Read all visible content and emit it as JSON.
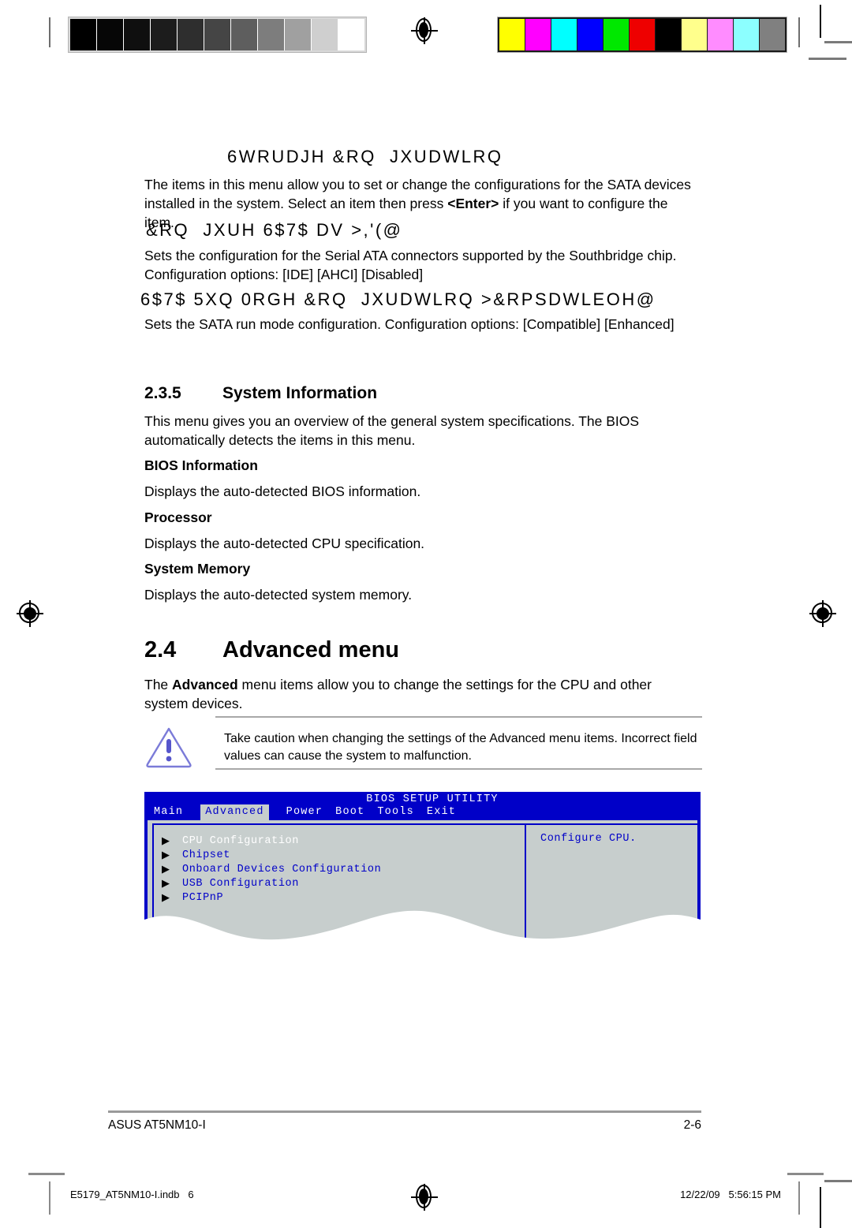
{
  "print_marks": {
    "grayscale_patches": [
      "#000000",
      "#060606",
      "#0f0f0f",
      "#1c1c1c",
      "#2e2e2e",
      "#454545",
      "#5e5e5e",
      "#7d7d7d",
      "#a0a0a0",
      "#cfcfcf",
      "#ffffff"
    ],
    "color_patches": [
      "#ffff00",
      "#ff00ff",
      "#00ffff",
      "#0000ff",
      "#00e800",
      "#ee0000",
      "#000000",
      "#ffff8c",
      "#ff8cff",
      "#8cffff",
      "#808080"
    ],
    "registration_mark": "registration-target-icon"
  },
  "content": {
    "heading_storage_config": "6WRUDJH &RQ  JXUDWLRQ",
    "para_storage_1": "The items in this menu allow you to set or change the configurations for the SATA devices installed in the system. Select an item then press ",
    "para_storage_1_bold": "<Enter>",
    "para_storage_1_tail": " if you want to configure the item.",
    "heading_configure_sata": "&RQ  JXUH 6$7$ DV >,'(@",
    "para_configure_sata": "Sets the configuration for the Serial ATA connectors supported by the Southbridge chip. Configuration options: [IDE] [AHCI] [Disabled]",
    "heading_sata_run_mode": "6$7$ 5XQ 0RGH &RQ  JXUDWLRQ >&RPSDWLEOH@",
    "para_sata_run_mode": "Sets the SATA run mode configuration. Configuration options: [Compatible] [Enhanced]",
    "section_235_number": "2.3.5",
    "section_235_title": "System Information",
    "para_235": "This menu gives you an overview of the general system specifications. The BIOS automatically detects the items in this menu.",
    "subhead_bios_information": "BIOS Information",
    "para_bios_information": "Displays the auto-detected BIOS information.",
    "subhead_processor": "Processor",
    "para_processor": "Displays the auto-detected CPU specification.",
    "subhead_system_memory": "System Memory",
    "para_system_memory": "Displays the auto-detected system memory.",
    "section_24_number": "2.4",
    "section_24_title": "Advanced menu",
    "para_24_pre": "The ",
    "para_24_bold": "Advanced",
    "para_24_post": " menu items allow you to change the settings for the CPU and other system devices."
  },
  "note": {
    "icon": "caution-triangle-icon",
    "text": "Take caution when changing the settings of the Advanced menu items. Incorrect field values can cause the system to malfunction."
  },
  "bios": {
    "title": "BIOS SETUP UTILITY",
    "tabs": [
      {
        "label": "Main",
        "active": false
      },
      {
        "label": "Advanced",
        "active": true
      },
      {
        "label": "Power",
        "active": false
      },
      {
        "label": "Boot",
        "active": false
      },
      {
        "label": "Tools",
        "active": false
      },
      {
        "label": "Exit",
        "active": false
      }
    ],
    "menu_items": [
      {
        "label": "CPU Configuration",
        "selected": true
      },
      {
        "label": "Chipset",
        "selected": false
      },
      {
        "label": "Onboard Devices Configuration",
        "selected": false
      },
      {
        "label": "USB Configuration",
        "selected": false
      },
      {
        "label": "PCIPnP",
        "selected": false
      }
    ],
    "help_text": "Configure CPU.",
    "arrow_glyph": "▶",
    "colors": {
      "chrome_blue": "#0000c8",
      "panel_gray": "#c7cecd",
      "selected_text": "#ffffff",
      "item_text": "#0000c8"
    }
  },
  "footer": {
    "left": "ASUS AT5NM10-I",
    "right": "2-6"
  },
  "slug": {
    "left": "E5179_AT5NM10-I.indb   6",
    "right": "12/22/09   5:56:15 PM"
  }
}
